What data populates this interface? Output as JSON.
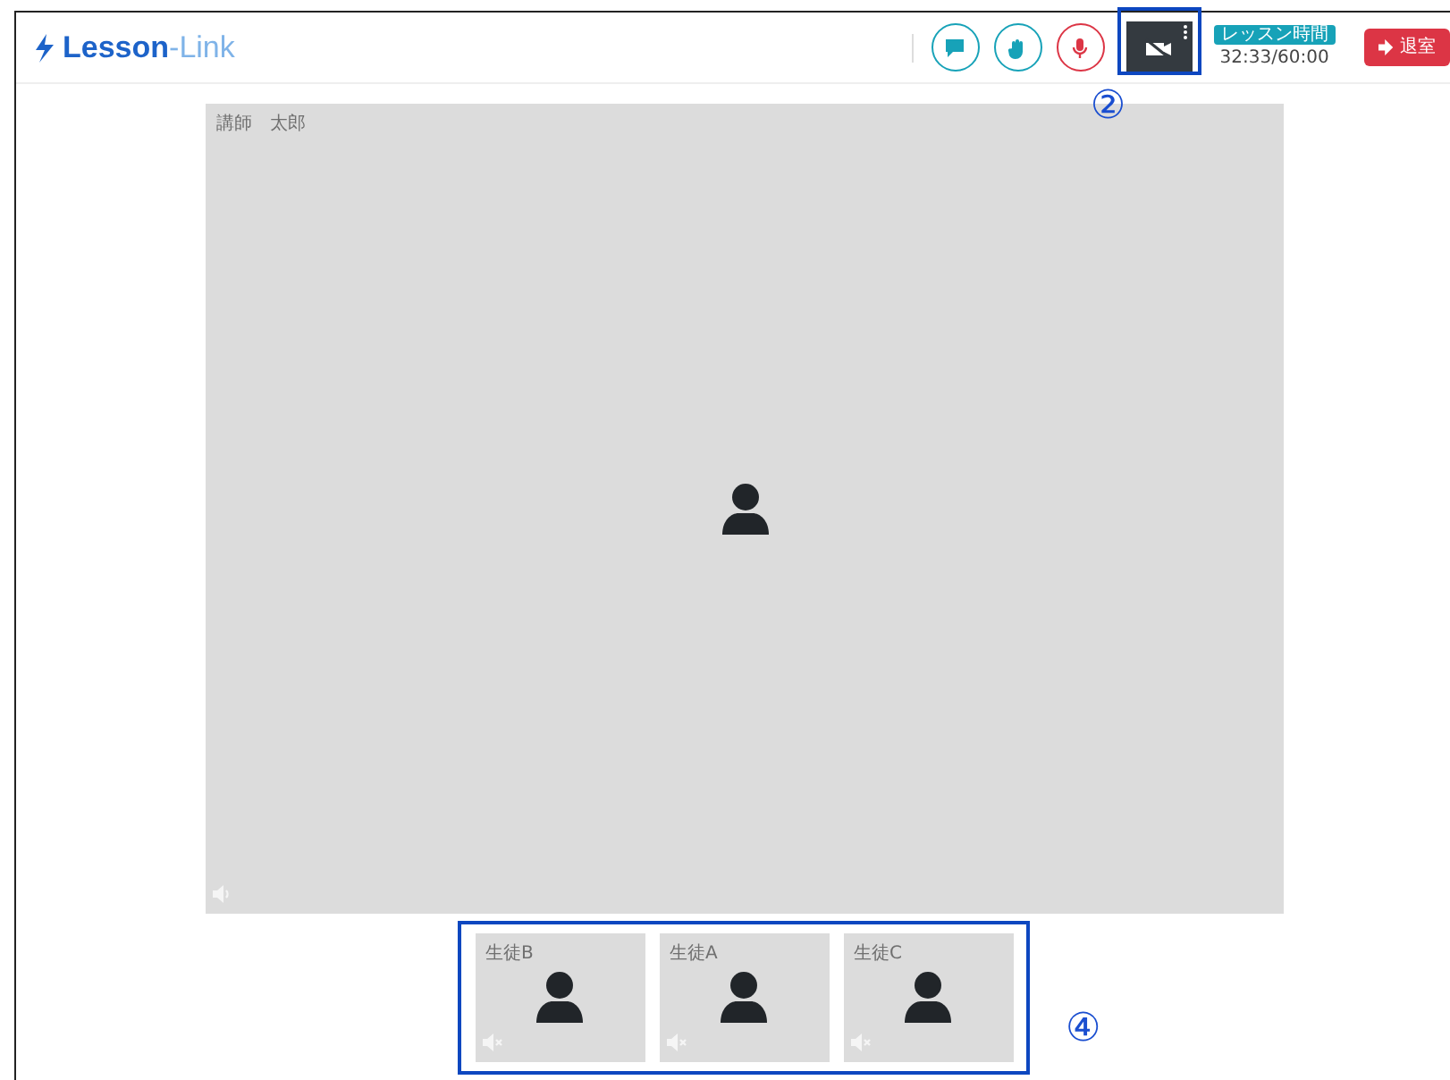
{
  "header": {
    "logo": {
      "main": "Lesson",
      "accent": "-Link"
    },
    "controls": [
      {
        "kind": "chat",
        "color": "#17a2b8"
      },
      {
        "kind": "hand",
        "color": "#17a2b8"
      },
      {
        "kind": "mic",
        "color": "#dc3545"
      },
      {
        "kind": "camera-off",
        "color": "#343a40",
        "annotation": "②"
      }
    ],
    "timer": {
      "label": "レッスン時間",
      "value": "32:33/60:00"
    },
    "exit_button": {
      "label": "退室"
    }
  },
  "main_video": {
    "name": "講師　太郎",
    "muted": false
  },
  "participants": {
    "annotation": "④",
    "items": [
      {
        "name": "生徒B",
        "muted": true
      },
      {
        "name": "生徒A",
        "muted": true
      },
      {
        "name": "生徒C",
        "muted": true
      }
    ]
  }
}
